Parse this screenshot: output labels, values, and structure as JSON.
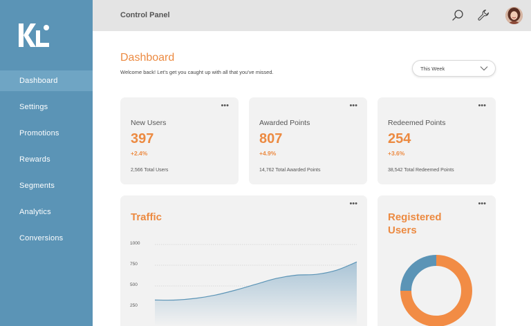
{
  "header": {
    "title": "Control Panel"
  },
  "sidebar": {
    "items": [
      {
        "label": "Dashboard",
        "active": true
      },
      {
        "label": "Settings"
      },
      {
        "label": "Promotions"
      },
      {
        "label": "Rewards"
      },
      {
        "label": "Segments"
      },
      {
        "label": "Analytics"
      },
      {
        "label": "Conversions"
      }
    ]
  },
  "icons": {
    "search": "search-icon",
    "settings": "wrench-icon",
    "menu": "more-dots-icon",
    "dropdown": "chevron-down-icon"
  },
  "main": {
    "title": "Dashboard",
    "subtitle": "Welcome back! Let's get you caught up with all that you've missed.",
    "period": {
      "selected": "This Week"
    }
  },
  "stats": [
    {
      "title": "New Users",
      "value": "397",
      "delta": "+2.4%",
      "total": "2,566 Total Users"
    },
    {
      "title": "Awarded Points",
      "value": "807",
      "delta": "+4.9%",
      "total": "14,762 Total Awarded Points"
    },
    {
      "title": "Redeemed Points",
      "value": "254",
      "delta": "+3.6%",
      "total": "38,542 Total Redeemed Points"
    }
  ],
  "traffic": {
    "title": "Traffic",
    "y_ticks": [
      "1000",
      "750",
      "500",
      "250"
    ]
  },
  "registered": {
    "title": "Registered Users"
  },
  "colors": {
    "accent": "#ec8a41",
    "sidebar": "#5b94b6",
    "sidebar_active": "#6fa5c4",
    "card": "#f2f2f2",
    "blue": "#5b94b6"
  },
  "chart_data": [
    {
      "type": "area",
      "title": "Traffic",
      "x": [
        0,
        1,
        2,
        3,
        4,
        5,
        6,
        7,
        8,
        9,
        10
      ],
      "values": [
        330,
        330,
        350,
        390,
        450,
        520,
        590,
        630,
        640,
        690,
        790
      ],
      "ylim": [
        0,
        1000
      ],
      "y_ticks": [
        1000,
        750,
        500,
        250
      ],
      "grid": true
    },
    {
      "type": "pie",
      "title": "Registered Users",
      "donut": true,
      "values": [
        75,
        25
      ],
      "colors": [
        "#f28c45",
        "#5b94b6"
      ]
    }
  ]
}
